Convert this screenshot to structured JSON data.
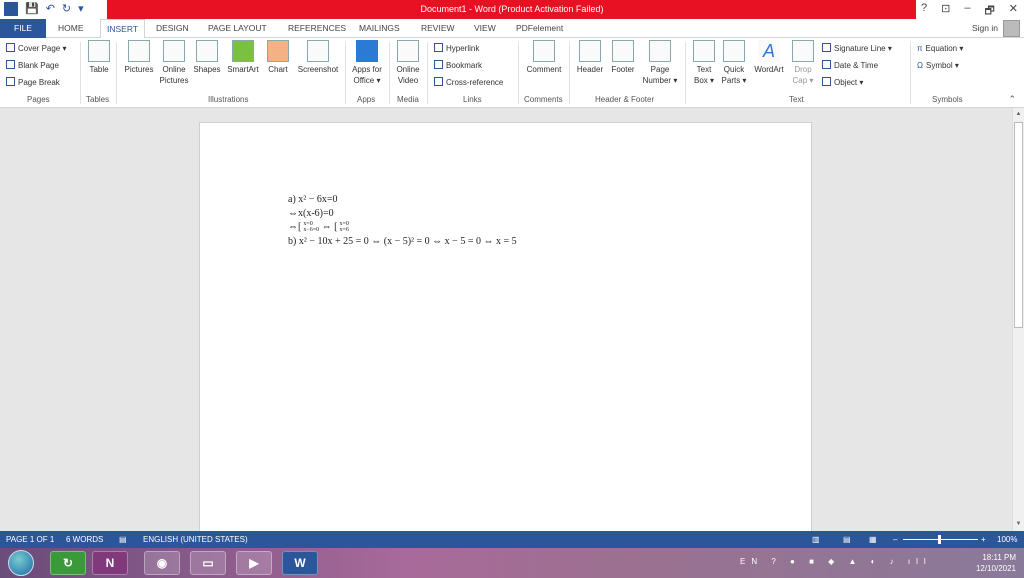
{
  "window": {
    "title": "Document1 - Word (Product Activation Failed)",
    "help": "?",
    "minimize": "–",
    "restore": "🗗",
    "close": "✕",
    "ribbon_display": "⊡"
  },
  "qat": {
    "save": "💾",
    "undo": "↶",
    "redo": "↻",
    "customize": "▾"
  },
  "tabs": [
    "FILE",
    "HOME",
    "INSERT",
    "DESIGN",
    "PAGE LAYOUT",
    "REFERENCES",
    "MAILINGS",
    "REVIEW",
    "VIEW",
    "PDFelement"
  ],
  "active_tab": "INSERT",
  "sign_in": "Sign in",
  "ribbon": {
    "pages": {
      "items": [
        "Cover Page ▾",
        "Blank Page",
        "Page Break"
      ],
      "group": "Pages"
    },
    "tables": {
      "table": "Table",
      "group": "Tables"
    },
    "illustrations": {
      "pictures": "Pictures",
      "online_pictures_1": "Online",
      "online_pictures_2": "Pictures",
      "shapes": "Shapes",
      "smartart": "SmartArt",
      "chart": "Chart",
      "screenshot": "Screenshot",
      "group": "Illustrations"
    },
    "apps": {
      "apps_1": "Apps for",
      "apps_2": "Office ▾",
      "group": "Apps"
    },
    "media": {
      "video_1": "Online",
      "video_2": "Video",
      "group": "Media"
    },
    "links": {
      "items": [
        "Hyperlink",
        "Bookmark",
        "Cross-reference"
      ],
      "group": "Links"
    },
    "comments": {
      "comment": "Comment",
      "group": "Comments"
    },
    "header_footer": {
      "header": "Header",
      "footer": "Footer",
      "page_number_1": "Page",
      "page_number_2": "Number ▾",
      "group": "Header & Footer"
    },
    "text": {
      "text_box_1": "Text",
      "text_box_2": "Box ▾",
      "quick_parts_1": "Quick",
      "quick_parts_2": "Parts ▾",
      "wordart": "WordArt",
      "drop_cap_1": "Drop",
      "drop_cap_2": "Cap ▾",
      "side": [
        "Signature Line ▾",
        "Date & Time",
        "Object ▾"
      ],
      "group": "Text"
    },
    "symbols": {
      "equation": "Equation ▾",
      "symbol": "Symbol ▾",
      "group": "Symbols"
    }
  },
  "document": {
    "lines": [
      "a) x² − 6x=0",
      "⇔x(x-6)=0",
      "⇔[",
      "b) x² − 10x + 25 = 0 ⇔ (x − 5)² = 0 ⇔ x − 5 = 0 ⇔ x = 5"
    ],
    "bracket1_top": "x=0",
    "bracket1_bottom": "x−6=0",
    "iff": "⇔",
    "bracket2_top": "x=0",
    "bracket2_bottom": "x=6"
  },
  "status": {
    "page": "PAGE 1 OF 1",
    "words": "6 WORDS",
    "language": "ENGLISH (UNITED STATES)",
    "zoom": "100%",
    "zoom_minus": "–",
    "zoom_plus": "+"
  },
  "taskbar": {
    "lang": "EN",
    "time": "18:11 PM",
    "date": "12/10/2021",
    "apps": [
      "N",
      "W"
    ]
  }
}
